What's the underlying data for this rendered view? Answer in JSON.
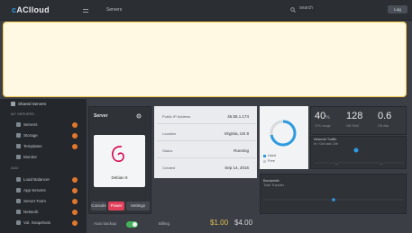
{
  "header": {
    "logo_brand": "c",
    "logo_rest": "ACIloud",
    "nav_link": "Servers",
    "search_label": "search",
    "right_button": "Log"
  },
  "alert": {
    "message": ""
  },
  "sidebar": {
    "top_item": "Shared Servers",
    "section_1": "MY SERVERS",
    "items_1": [
      "Servers",
      "Storage",
      "Templates",
      "Monitor"
    ],
    "section_2": "ADD",
    "items_2": [
      "Load Balancer",
      "App Servers",
      "Server Farm",
      "Network",
      "Vol. Snapshots"
    ]
  },
  "server": {
    "name": "Server",
    "os_caption": "Debian 8",
    "buttons": {
      "console": "Console",
      "power": "Power",
      "settings": "Settings"
    }
  },
  "details": {
    "rows": [
      {
        "label": "Public IP Address",
        "value": "45.55.1.174"
      },
      {
        "label": "Location",
        "value": "Virginia, US 8"
      },
      {
        "label": "Status",
        "value": "Running"
      },
      {
        "label": "Created",
        "value": "Sep 14, 2016"
      }
    ]
  },
  "stats": {
    "cpu": {
      "value": "40",
      "unit": "%",
      "caption": "CPU usage"
    },
    "ram": {
      "value": "128",
      "unit": "",
      "caption": "MB RAM"
    },
    "disk": {
      "value": "0.6",
      "unit": "",
      "caption": "GB disk"
    }
  },
  "donut": {
    "used_fraction": 0.72,
    "legend": [
      "Used",
      "Free"
    ]
  },
  "small_chart": {
    "title": "Network Traffic",
    "subtitle": "In / Out last 24h"
  },
  "bandwidth_chart": {
    "title": "Bandwidth",
    "subtitle": "Total Transfer"
  },
  "footer": {
    "label": "Auto backup",
    "toggle_label": "Billing",
    "price_current": "$1.00",
    "price_next": "$4.00"
  },
  "colors": {
    "accent": "#2d9be0",
    "danger": "#e0405a",
    "warning_bg": "#fff9e3",
    "warning_border": "#f0c94a",
    "toggle_on": "#45b35c",
    "sidebar_dot": "#e2772e"
  }
}
